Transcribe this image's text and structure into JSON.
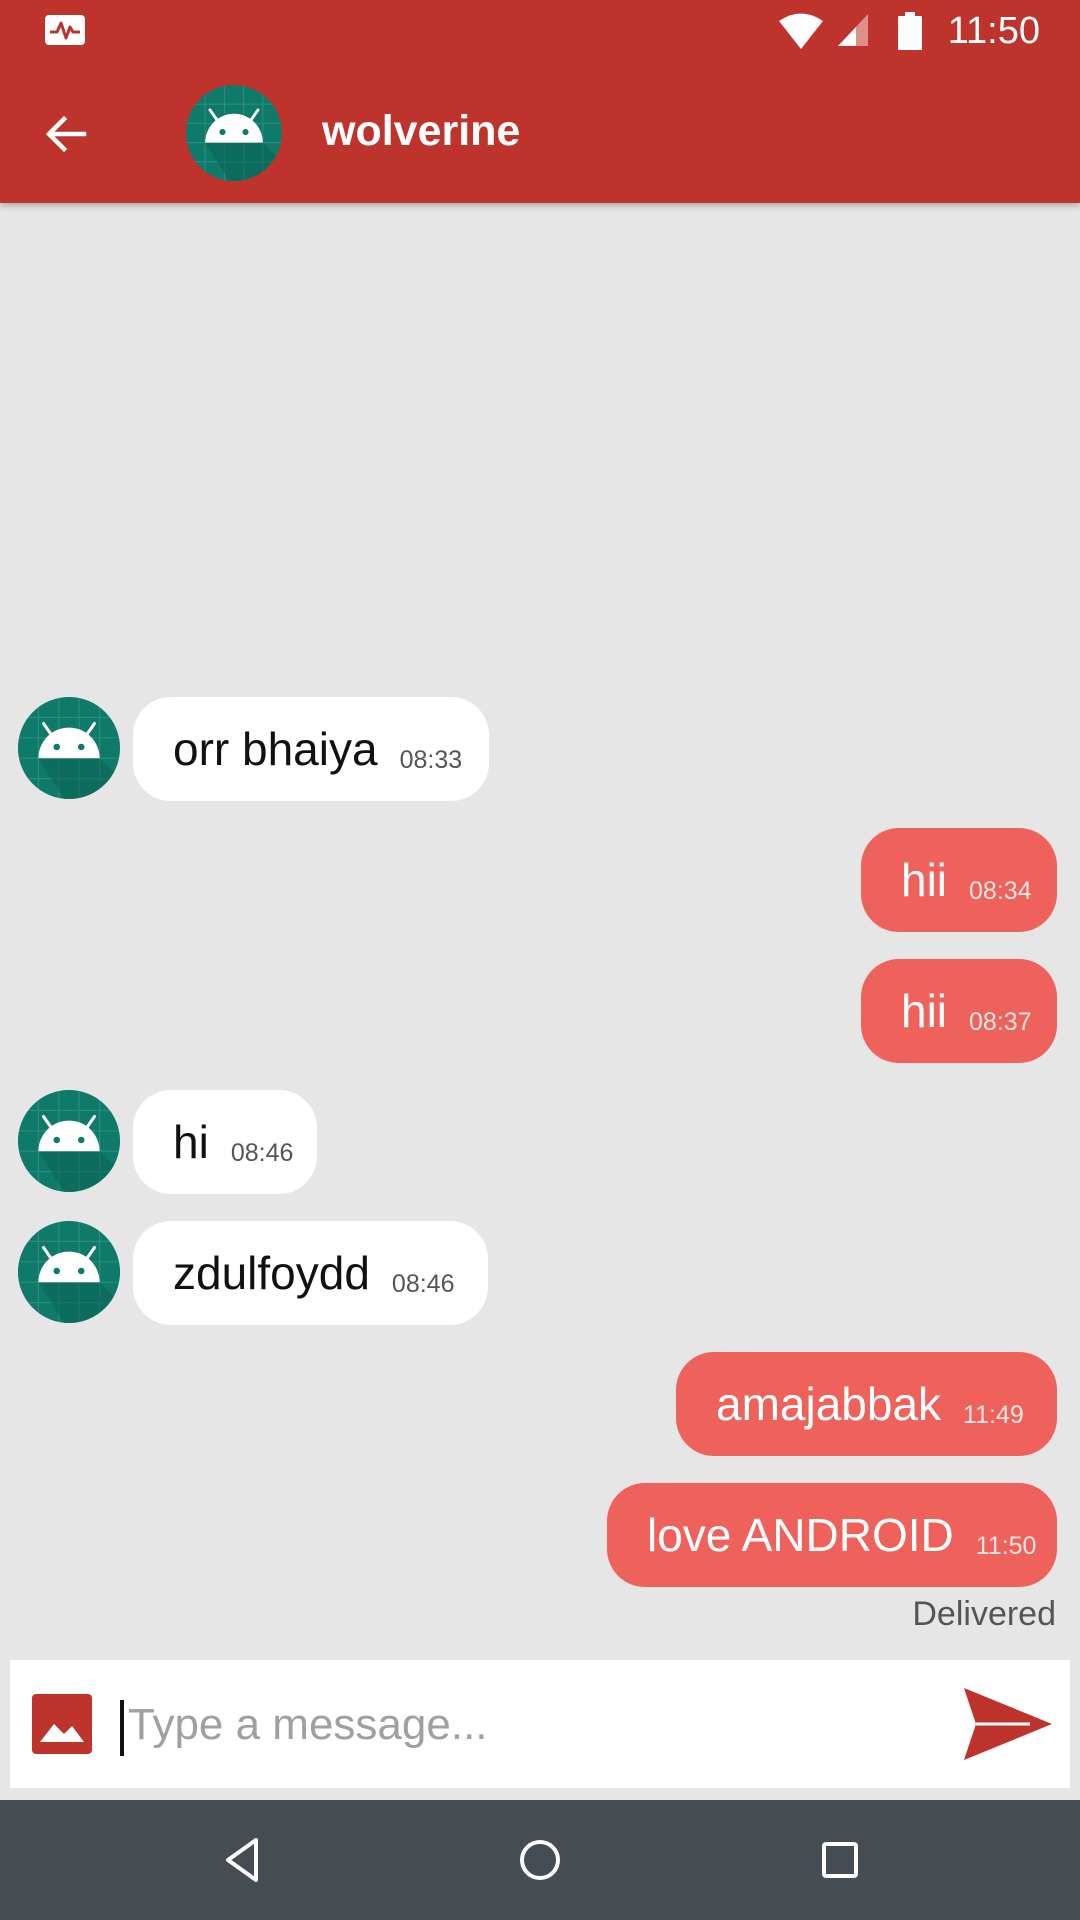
{
  "status_bar": {
    "time": "11:50",
    "icons": [
      "activity-pulse-icon",
      "wifi-icon",
      "cell-signal-icon",
      "battery-icon"
    ]
  },
  "app_bar": {
    "back_icon": "arrow-back-icon",
    "contact_name": "wolverine",
    "avatar_icon": "android-avatar-icon"
  },
  "messages": [
    {
      "direction": "incoming",
      "text": "orr bhaiya",
      "time": "08:33"
    },
    {
      "direction": "outgoing",
      "text": "hii",
      "time": "08:34"
    },
    {
      "direction": "outgoing",
      "text": "hii",
      "time": "08:37"
    },
    {
      "direction": "incoming",
      "text": "hi",
      "time": "08:46"
    },
    {
      "direction": "incoming",
      "text": "zdulfoydd",
      "time": "08:46"
    },
    {
      "direction": "outgoing",
      "text": "amajabbak",
      "time": "11:49"
    },
    {
      "direction": "outgoing",
      "text": "love ANDROID",
      "time": "11:50"
    }
  ],
  "delivery_status": "Delivered",
  "composer": {
    "placeholder": "Type a message...",
    "value": "",
    "gallery_icon": "image-gallery-icon",
    "send_icon": "send-icon"
  },
  "nav_bar": {
    "icons": [
      "nav-back-icon",
      "nav-home-icon",
      "nav-recents-icon"
    ]
  },
  "colors": {
    "primary": "#bf332d",
    "outgoing_bubble": "#ee625b",
    "incoming_bubble": "#ffffff",
    "chat_background": "#e6e6e6",
    "avatar": "#0f7a6a",
    "nav_bar": "#454c52"
  }
}
